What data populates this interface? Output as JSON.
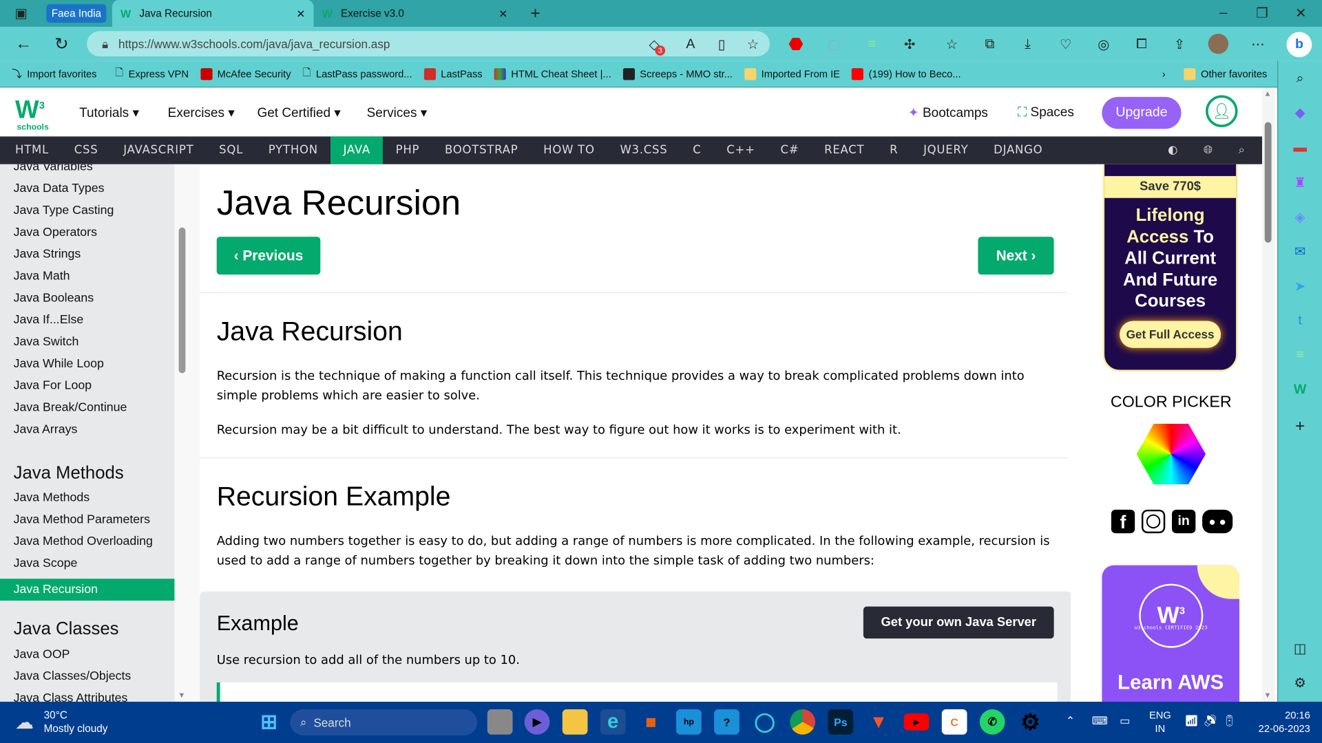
{
  "browser": {
    "profile_label": "Faea India",
    "tabs": [
      {
        "title": "Java Recursion",
        "active": true
      },
      {
        "title": "Exercise v3.0",
        "active": false
      }
    ],
    "url": "https://www.w3schools.com/java/java_recursion.asp",
    "tracker_badge": "3",
    "bookmarks": [
      "Import favorites",
      "Express VPN",
      "McAfee Security",
      "LastPass password...",
      "LastPass",
      "HTML Cheat Sheet |...",
      "Screeps - MMO str...",
      "Imported From IE",
      "(199) How to Beco..."
    ],
    "other_favorites": "Other favorites"
  },
  "site": {
    "logo": "w3 schools",
    "menus": [
      "Tutorials",
      "Exercises",
      "Get Certified",
      "Services"
    ],
    "bootcamps": "Bootcamps",
    "spaces": "Spaces",
    "upgrade": "Upgrade",
    "nav": [
      "HTML",
      "CSS",
      "JAVASCRIPT",
      "SQL",
      "PYTHON",
      "JAVA",
      "PHP",
      "BOOTSTRAP",
      "HOW TO",
      "W3.CSS",
      "C",
      "C++",
      "C#",
      "REACT",
      "R",
      "JQUERY",
      "DJANGO"
    ],
    "nav_active": "JAVA"
  },
  "sidebar": {
    "items_a": [
      "Java Variables",
      "Java Data Types",
      "Java Type Casting",
      "Java Operators",
      "Java Strings",
      "Java Math",
      "Java Booleans",
      "Java If...Else",
      "Java Switch",
      "Java While Loop",
      "Java For Loop",
      "Java Break/Continue",
      "Java Arrays"
    ],
    "heading_methods": "Java Methods",
    "items_b": [
      "Java Methods",
      "Java Method Parameters",
      "Java Method Overloading",
      "Java Scope",
      "Java Recursion"
    ],
    "selected": "Java Recursion",
    "heading_classes": "Java Classes",
    "items_c": [
      "Java OOP",
      "Java Classes/Objects",
      "Java Class Attributes"
    ]
  },
  "main": {
    "title": "Java Recursion",
    "prev": "Previous",
    "next": "Next",
    "h2_1": "Java Recursion",
    "p1": "Recursion is the technique of making a function call itself. This technique provides a way to break complicated problems down into simple problems which are easier to solve.",
    "p2": "Recursion may be a bit difficult to understand. The best way to figure out how it works is to experiment with it.",
    "h2_2": "Recursion Example",
    "p3": "Adding two numbers together is easy to do, but adding a range of numbers is more complicated. In the following example, recursion is used to add a range of numbers together by breaking it down into the simple task of adding two numbers:",
    "example_title": "Example",
    "server_button": "Get your own Java Server",
    "example_desc": "Use recursion to add all of the numbers up to 10."
  },
  "right": {
    "ad_save": "Save 770$",
    "ad_line1": "Lifelong",
    "ad_line2a": "Access",
    "ad_line2b": "To",
    "ad_line3": "All Current",
    "ad_line4": "And Future",
    "ad_line5": "Courses",
    "ad_button": "Get Full Access",
    "color_picker": "COLOR PICKER",
    "aws_text": "Learn AWS",
    "aws_badge": "w3schools CERTIFIED 2023"
  },
  "taskbar": {
    "temp": "30°C",
    "weather": "Mostly cloudy",
    "search": "Search",
    "lang1": "ENG",
    "lang2": "IN",
    "time": "20:16",
    "date": "22-06-2023"
  },
  "colors": {
    "accent": "#04aa6d",
    "nav": "#282a35",
    "browser": "#61d0d1",
    "upgrade": "#9763f6"
  }
}
